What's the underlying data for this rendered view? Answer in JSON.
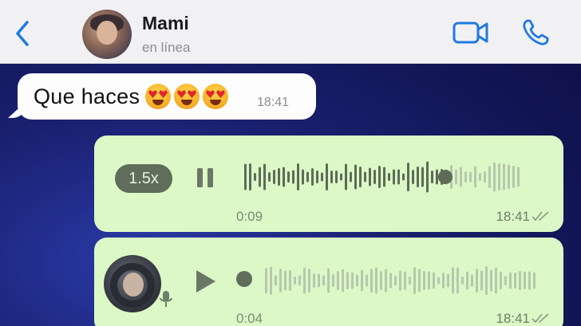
{
  "header": {
    "contact_name": "Mami",
    "contact_status": "en línea",
    "icons": {
      "back": "chevron-left-icon",
      "video": "video-camera-icon",
      "call": "phone-icon"
    },
    "accent_color": "#1f7ae0"
  },
  "messages": {
    "incoming": {
      "text": "Que haces",
      "emojis": [
        "heart-eyes-emoji",
        "heart-eyes-emoji",
        "heart-eyes-emoji"
      ],
      "time": "18:41"
    },
    "voice_1": {
      "speed": "1.5x",
      "state": "playing",
      "duration": "0:09",
      "time": "18:41",
      "progress": 0.72
    },
    "voice_2": {
      "state": "paused",
      "duration": "0:04",
      "time": "18:41",
      "progress": 0.0
    }
  },
  "colors": {
    "outgoing_bubble": "#dcf8c6",
    "incoming_bubble": "#fdfdfd",
    "header_bg": "#f1f1f4"
  }
}
